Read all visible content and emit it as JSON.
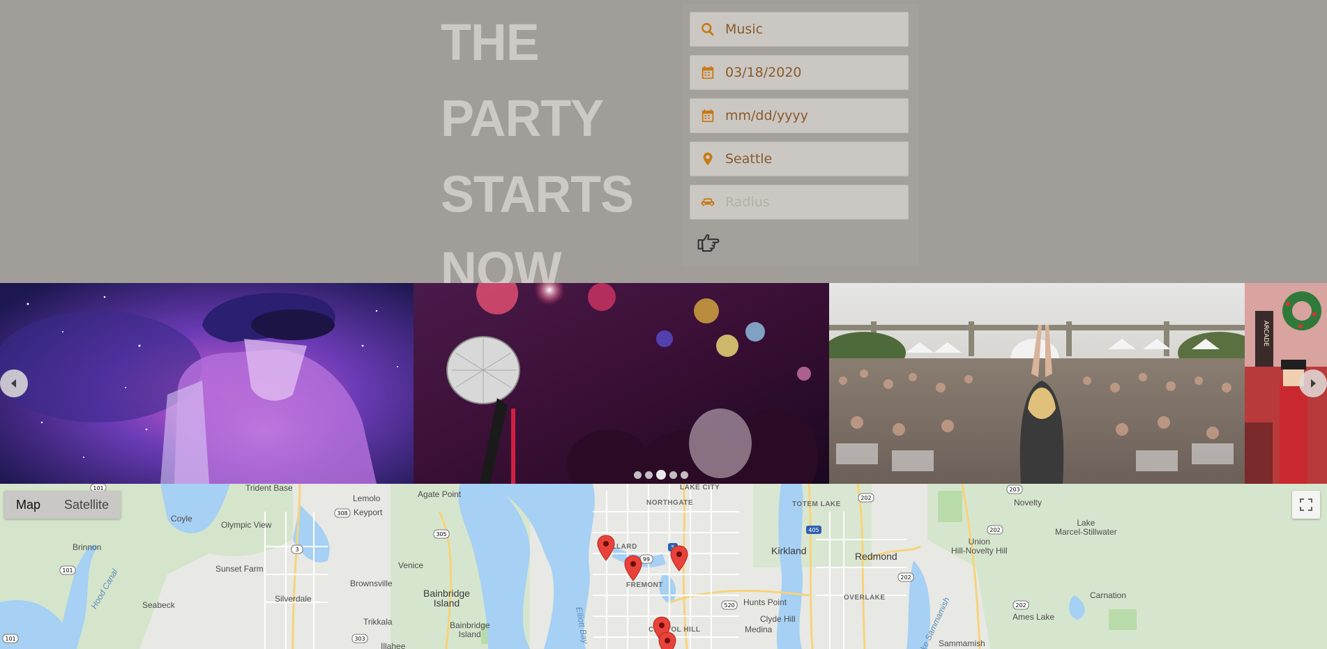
{
  "header": {
    "headline_lines": [
      "THE PARTY",
      "STARTS",
      "NOW"
    ]
  },
  "search": {
    "keyword": {
      "value": "Music",
      "icon": "search-icon"
    },
    "start_date": {
      "value": "03/18/2020",
      "icon": "calendar-icon"
    },
    "end_date": {
      "placeholder": "mm/dd/yyyy",
      "icon": "calendar-icon"
    },
    "location": {
      "value": "Seattle",
      "icon": "map-marker-icon"
    },
    "radius": {
      "placeholder": "Radius",
      "icon": "car-icon"
    },
    "submit_icon": "hand-pointer-right-icon"
  },
  "carousel": {
    "slides": [
      "dj-galaxy-image",
      "microphone-concert-image",
      "outdoor-yoga-festival-image",
      "holiday-arcade-image"
    ],
    "dot_count": 5,
    "active_dot": 2
  },
  "map": {
    "type_buttons": [
      "Map",
      "Satellite"
    ],
    "active_type": "Map",
    "labels": {
      "trident_base": "Trident Base",
      "agate_point": "Agate Point",
      "lemolo": "Lemolo",
      "keyport": "Keyport",
      "coyle": "Coyle",
      "olympic_view": "Olympic View",
      "brinnon": "Brinnon",
      "sunset_farm": "Sunset Farm",
      "brownsville": "Brownsville",
      "venice": "Venice",
      "bainbridge_island": "Bainbridge\nIsland",
      "bainbridge_island_2": "Bainbridge\nIsland",
      "silverdale": "Silverdale",
      "seabeck": "Seabeck",
      "hood_canal": "Hood Canal",
      "trikkala": "Trikkala",
      "illahee": "Illahee",
      "elliott_bay": "Elliott Bay",
      "lake_city": "LAKE CITY",
      "northgate": "NORTHGATE",
      "ballard": "BALLARD",
      "fremont": "FREMONT",
      "capitol_hill": "CAPITOL HILL",
      "totem_lake": "TOTEM LAKE",
      "kirkland": "Kirkland",
      "redmond": "Redmond",
      "overlake": "OVERLAKE",
      "hunts_point": "Hunts Point",
      "clyde_hill": "Clyde Hill",
      "medina": "Medina",
      "novelty": "Novelty",
      "lake_marcel": "Lake\nMarcel-Stillwater",
      "union_hill": "Union\nHill-Novelty Hill",
      "carnation": "Carnation",
      "ames_lake": "Ames Lake",
      "sammamish": "Sammamish",
      "lake_sammamish": "Lake Sammamish"
    },
    "highway_shields": [
      "101",
      "308",
      "3",
      "305",
      "303",
      "99",
      "5",
      "405",
      "520",
      "202",
      "203",
      "202",
      "202",
      "202",
      "101",
      "101"
    ],
    "pin_count": 5,
    "fullscreen_icon": "fullscreen-icon"
  }
}
